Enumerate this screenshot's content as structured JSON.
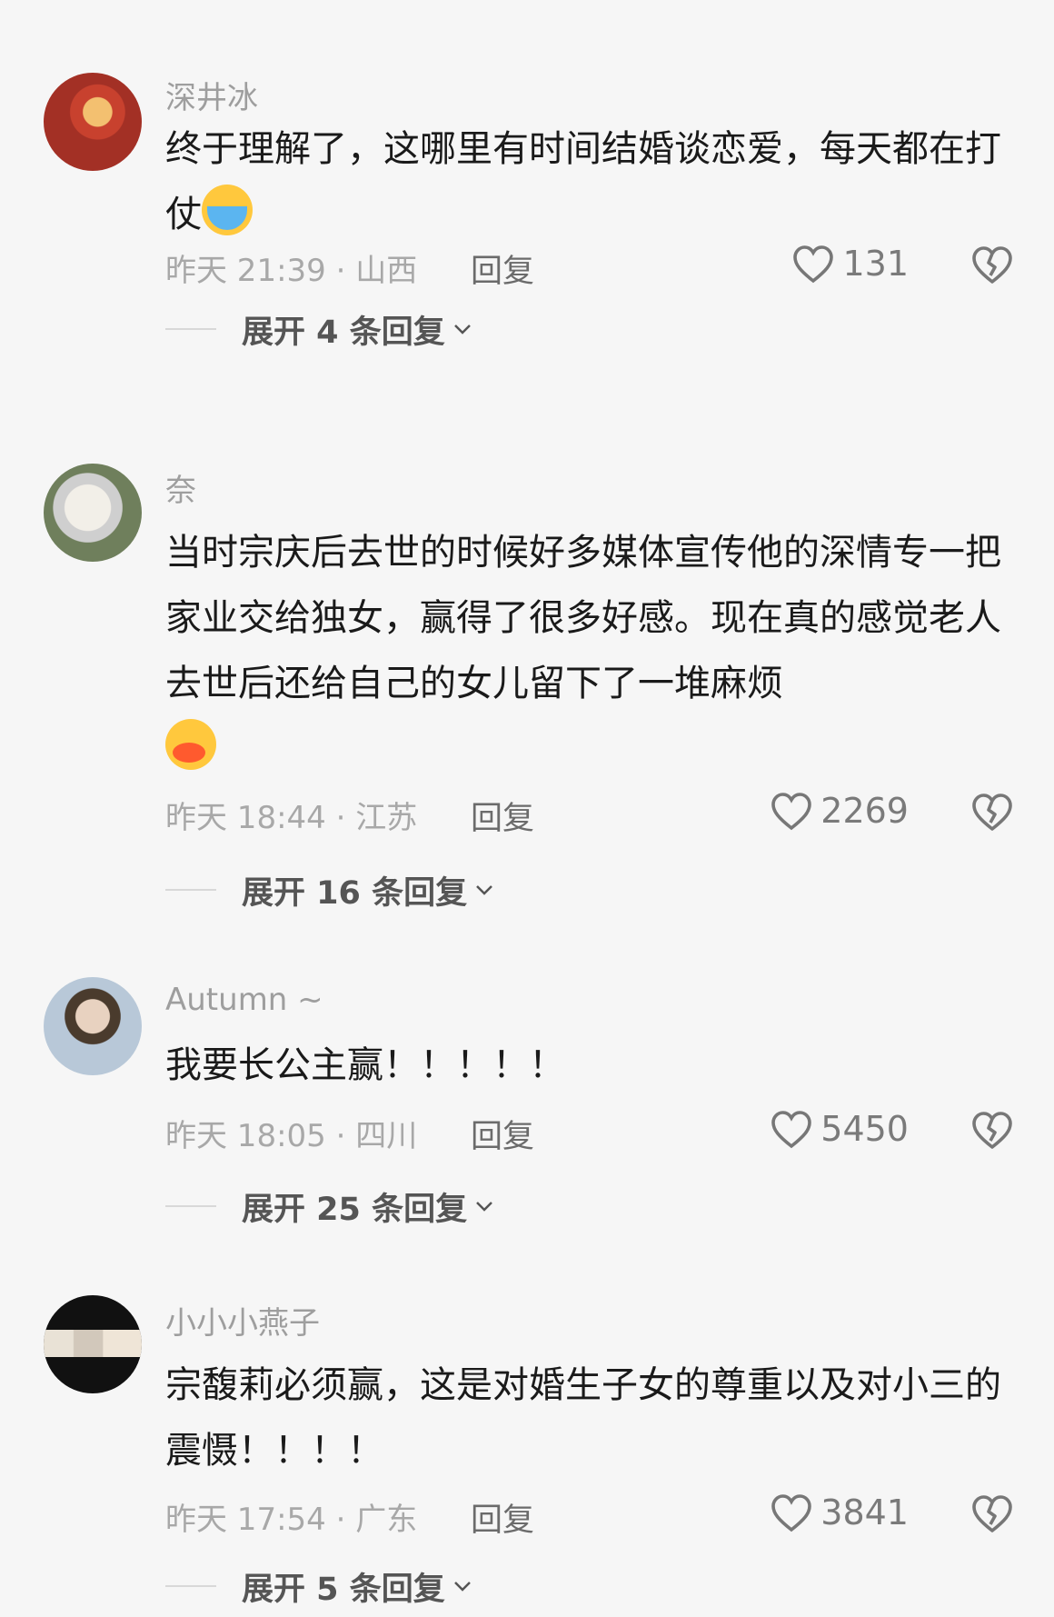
{
  "comments": [
    {
      "username": "深井冰",
      "text": "终于理解了，这哪里有时间结婚谈恋爱，每天都在打仗",
      "emoji": "crying-face",
      "meta": "昨天 21:39 · 山西",
      "reply_label": "回复",
      "likes": "131",
      "expand_label": "展开 4 条回复"
    },
    {
      "username": "奈",
      "text": "当时宗庆后去世的时候好多媒体宣传他的深情专一把家业交给独女，赢得了很多好感。现在真的感觉老人去世后还给自己的女儿留下了一堆麻烦",
      "emoji": "duck-lips-face",
      "meta": "昨天 18:44 · 江苏",
      "reply_label": "回复",
      "likes": "2269",
      "expand_label": "展开 16 条回复"
    },
    {
      "username": "Autumn ~",
      "text": "我要长公主赢！！！！！",
      "meta": "昨天 18:05 · 四川",
      "reply_label": "回复",
      "likes": "5450",
      "expand_label": "展开 25 条回复"
    },
    {
      "username": "小小小燕子",
      "text": "宗馥莉必须赢，这是对婚生子女的尊重以及对小三的震慑！！！！",
      "meta": "昨天 17:54 · 广东",
      "reply_label": "回复",
      "likes": "3841",
      "expand_label": "展开 5 条回复"
    }
  ],
  "colors": {
    "background": "#f6f6f6",
    "text": "#1a1a1a",
    "secondary": "#a8a8a8"
  }
}
